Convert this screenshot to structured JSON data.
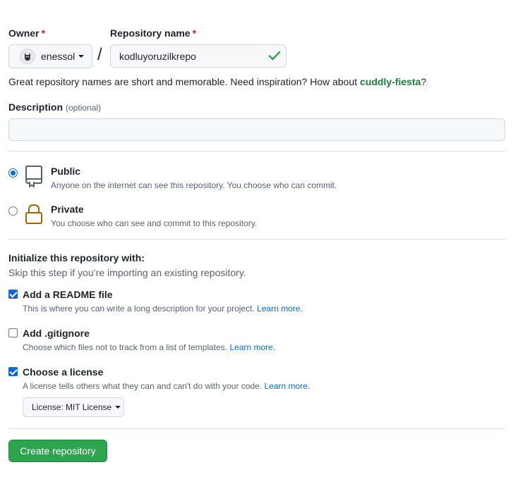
{
  "owner": {
    "label": "Owner",
    "required_mark": "*",
    "selected": "enessol",
    "icon": "avatar-icon"
  },
  "separator": "/",
  "repo": {
    "label": "Repository name",
    "required_mark": "*",
    "value": "kodluyoruzilkrepo",
    "status_icon": "check-icon",
    "status_color": "#2da44e"
  },
  "hint": {
    "text": "Great repository names are short and memorable. Need inspiration? How about ",
    "suggestion": "cuddly-fiesta",
    "suffix": "?"
  },
  "description": {
    "label": "Description",
    "optional": "(optional)",
    "value": "",
    "placeholder": ""
  },
  "visibility": {
    "selected": "public",
    "options": [
      {
        "id": "public",
        "title": "Public",
        "subtitle": "Anyone on the internet can see this repository. You choose who can commit.",
        "icon": "repo-book-icon"
      },
      {
        "id": "private",
        "title": "Private",
        "subtitle": "You choose who can see and commit to this repository.",
        "icon": "lock-icon"
      }
    ]
  },
  "initialize": {
    "title": "Initialize this repository with:",
    "subtitle": "Skip this step if you’re importing an existing repository.",
    "items": [
      {
        "checked": true,
        "label": "Add a README file",
        "desc": "This is where you can write a long description for your project.",
        "link": "Learn more."
      },
      {
        "checked": false,
        "label": "Add .gitignore",
        "desc": "Choose which files not to track from a list of templates.",
        "link": "Learn more."
      },
      {
        "checked": true,
        "label": "Choose a license",
        "desc": "A license tells others what they can and can't do with your code.",
        "link": "Learn more."
      }
    ],
    "license_select": "License: MIT License"
  },
  "submit": {
    "label": "Create repository",
    "color": "#2da44e"
  }
}
